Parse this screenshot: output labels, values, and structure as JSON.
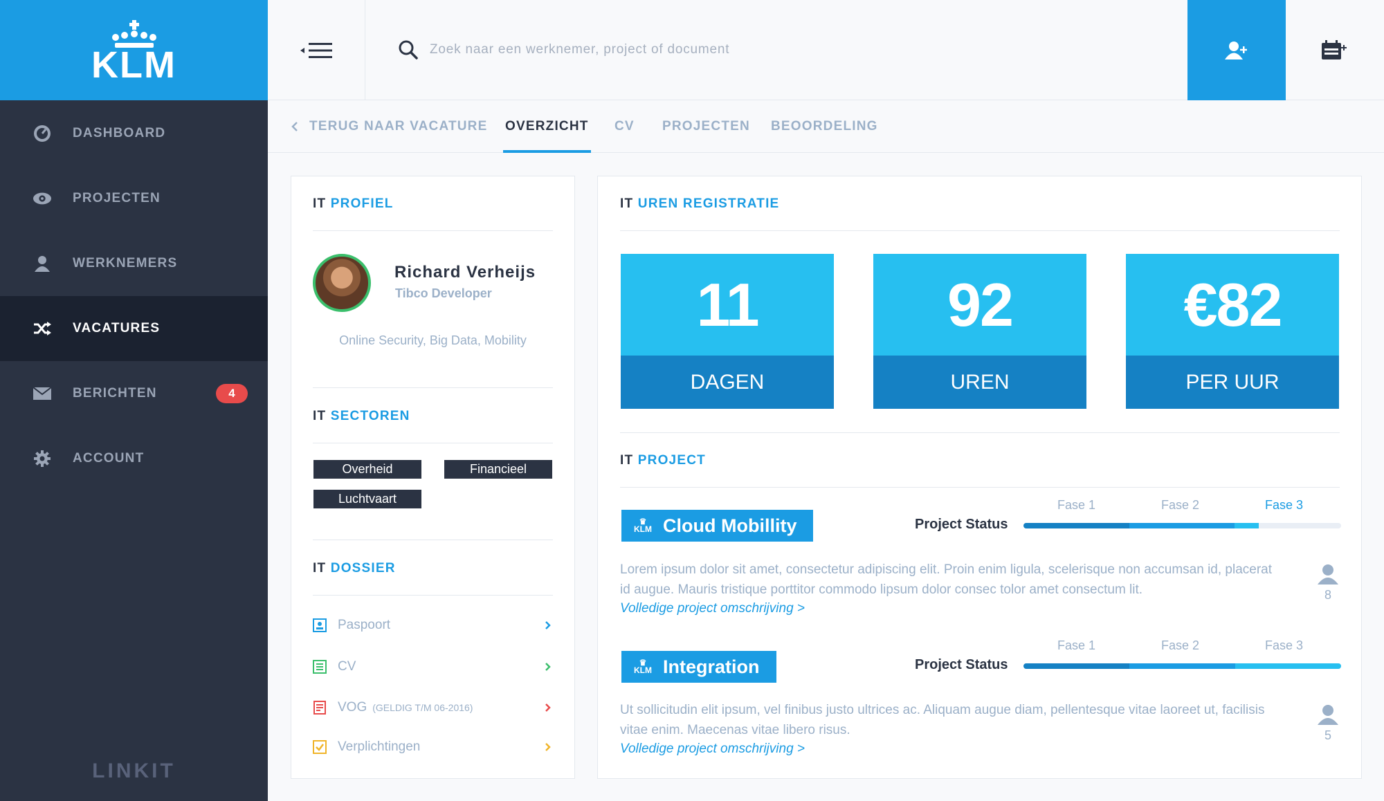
{
  "brand": {
    "logo_text": "KLM",
    "footer_logo": "LINKIT",
    "accent": "#1b9ce3"
  },
  "sidebar": {
    "items": [
      {
        "label": "DASHBOARD",
        "icon": "dashboard-icon"
      },
      {
        "label": "PROJECTEN",
        "icon": "eye-icon"
      },
      {
        "label": "WERKNEMERS",
        "icon": "user-icon"
      },
      {
        "label": "VACATURES",
        "icon": "shuffle-icon",
        "active": true
      },
      {
        "label": "BERICHTEN",
        "icon": "envelope-icon",
        "badge": "4"
      },
      {
        "label": "ACCOUNT",
        "icon": "gear-icon"
      }
    ]
  },
  "search": {
    "placeholder": "Zoek naar een werknemer, project of document"
  },
  "tabs": [
    {
      "label": "TERUG NAAR VACATURE"
    },
    {
      "label": "OVERZICHT",
      "active": true
    },
    {
      "label": "CV"
    },
    {
      "label": "PROJECTEN"
    },
    {
      "label": "BEOORDELING"
    }
  ],
  "profile": {
    "title_prefix": "IT",
    "title": "PROFIEL",
    "name": "Richard Verheijs",
    "role": "Tibco Developer",
    "skills": "Online Security, Big Data, Mobility"
  },
  "sectors": {
    "title_prefix": "IT",
    "title": "SECTOREN",
    "tags": [
      "Overheid",
      "Financieel",
      "Luchtvaart"
    ]
  },
  "dossier": {
    "title_prefix": "IT",
    "title": "DOSSIER",
    "items": [
      {
        "label": "Paspoort",
        "note": "",
        "color": "#1b9ce3"
      },
      {
        "label": "CV",
        "note": "",
        "color": "#3bbf6c"
      },
      {
        "label": "VOG",
        "note": "(GELDIG T/M 06-2016)",
        "color": "#e84b4b"
      },
      {
        "label": "Verplichtingen",
        "note": "",
        "color": "#f0b429"
      }
    ]
  },
  "hours": {
    "title_prefix": "IT",
    "title": "UREN REGISTRATIE",
    "stats": [
      {
        "value": "11",
        "label": "DAGEN"
      },
      {
        "value": "92",
        "label": "UREN"
      },
      {
        "value": "€82",
        "label": "PER UUR"
      }
    ]
  },
  "project_section": {
    "title_prefix": "IT",
    "title": "PROJECT",
    "badge_logo": "KLM",
    "status_label": "Project Status",
    "link_text": "Volledige project omschrijving >",
    "projects": [
      {
        "name": "Cloud Mobillity",
        "phases": [
          "Fase 1",
          "Fase 2",
          "Fase 3"
        ],
        "active_phase": 3,
        "progress": 0.74,
        "description": "Lorem ipsum dolor sit amet, consectetur adipiscing elit. Proin enim ligula, scelerisque non accumsan id, placerat id augue. Mauris tristique porttitor commodo lipsum dolor consec tolor amet consectum lit.",
        "members": "8"
      },
      {
        "name": "Integration",
        "phases": [
          "Fase 1",
          "Fase 2",
          "Fase 3"
        ],
        "active_phase": 0,
        "progress": 1.0,
        "description": "Ut sollicitudin elit ipsum, vel finibus justo ultrices ac. Aliquam augue diam, pellentesque vitae laoreet ut, facilisis vitae enim. Maecenas vitae libero risus.",
        "members": "5"
      }
    ]
  }
}
